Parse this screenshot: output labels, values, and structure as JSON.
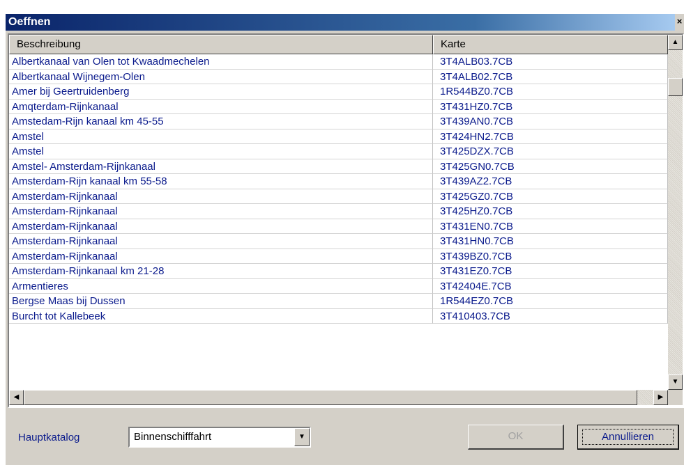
{
  "window": {
    "title": "Oeffnen",
    "close_glyph": "×"
  },
  "table": {
    "columns": [
      "Beschreibung",
      "Karte"
    ],
    "rows": [
      [
        "Albertkanaal van Olen tot Kwaadmechelen",
        "3T4ALB03.7CB"
      ],
      [
        "Albertkanaal Wijnegem-Olen",
        "3T4ALB02.7CB"
      ],
      [
        "Amer bij Geertruidenberg",
        "1R544BZ0.7CB"
      ],
      [
        "Amqterdam-Rijnkanaal",
        "3T431HZ0.7CB"
      ],
      [
        "Amstedam-Rijn kanaal km 45-55",
        "3T439AN0.7CB"
      ],
      [
        "Amstel",
        "3T424HN2.7CB"
      ],
      [
        "Amstel",
        "3T425DZX.7CB"
      ],
      [
        "Amstel- Amsterdam-Rijnkanaal",
        "3T425GN0.7CB"
      ],
      [
        "Amsterdam-Rijn kanaal km 55-58",
        "3T439AZ2.7CB"
      ],
      [
        "Amsterdam-Rijnkanaal",
        "3T425GZ0.7CB"
      ],
      [
        "Amsterdam-Rijnkanaal",
        "3T425HZ0.7CB"
      ],
      [
        "Amsterdam-Rijnkanaal",
        "3T431EN0.7CB"
      ],
      [
        "Amsterdam-Rijnkanaal",
        "3T431HN0.7CB"
      ],
      [
        "Amsterdam-Rijnkanaal",
        "3T439BZ0.7CB"
      ],
      [
        "Amsterdam-Rijnkanaal km 21-28",
        "3T431EZ0.7CB"
      ],
      [
        "Armentieres",
        "3T42404E.7CB"
      ],
      [
        "Bergse Maas bij Dussen",
        "1R544EZ0.7CB"
      ],
      [
        "Burcht tot Kallebeek",
        "3T410403.7CB"
      ]
    ]
  },
  "scrollbar": {
    "up": "▲",
    "down": "▼",
    "left": "◀",
    "right": "▶"
  },
  "footer": {
    "catalog_label": "Hauptkatalog",
    "catalog_value": "Binnenschifffahrt",
    "dropdown_glyph": "▼",
    "ok_label": "OK",
    "cancel_label": "Annullieren"
  }
}
